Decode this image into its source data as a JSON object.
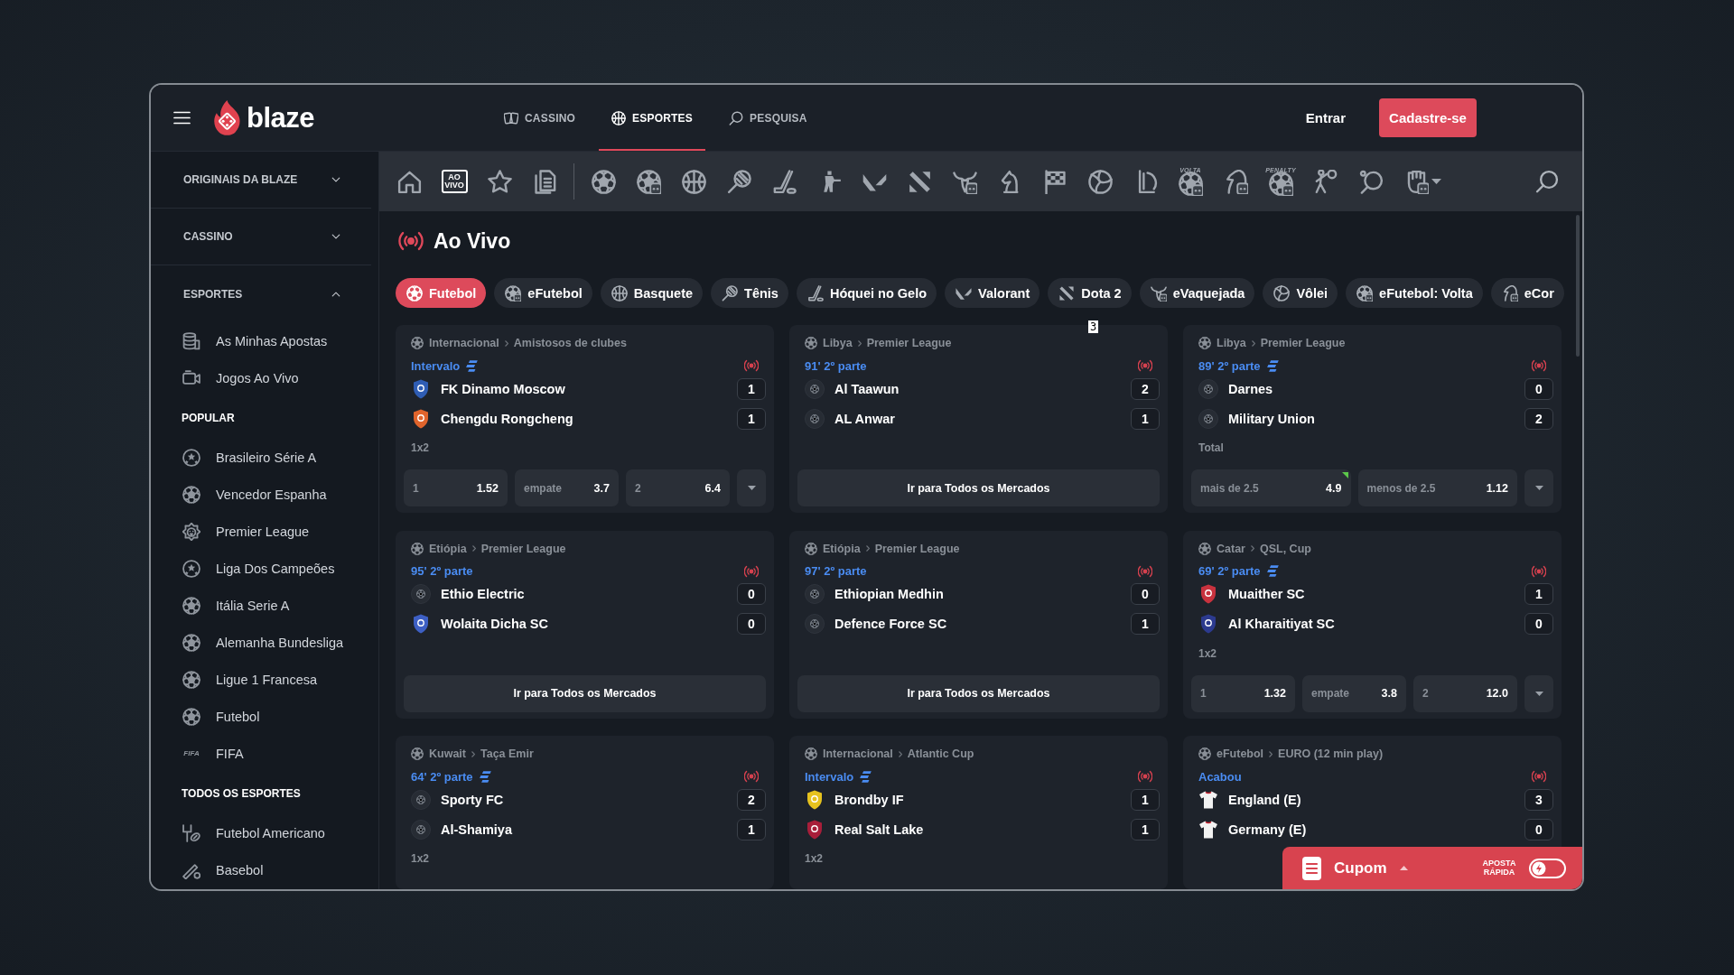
{
  "header": {
    "logo": "blaze",
    "nav": [
      {
        "label": "CASSINO",
        "selected": false
      },
      {
        "label": "ESPORTES",
        "selected": true
      },
      {
        "label": "PESQUISA",
        "selected": false
      }
    ],
    "login": "Entrar",
    "signup": "Cadastre-se"
  },
  "sidebar": {
    "sections": [
      {
        "title": "ORIGINAIS DA BLAZE",
        "expanded": false
      },
      {
        "title": "CASSINO",
        "expanded": false
      },
      {
        "title": "ESPORTES",
        "expanded": true,
        "items": [
          {
            "label": "As Minhas Apostas"
          },
          {
            "label": "Jogos Ao Vivo"
          }
        ],
        "groups": [
          {
            "title": "POPULAR",
            "items": [
              {
                "label": "Brasileiro Série A"
              },
              {
                "label": "Vencedor Espanha"
              },
              {
                "label": "Premier League"
              },
              {
                "label": "Liga Dos Campeões"
              },
              {
                "label": "Itália Serie A"
              },
              {
                "label": "Alemanha Bundesliga"
              },
              {
                "label": "Ligue 1 Francesa"
              },
              {
                "label": "Futebol"
              },
              {
                "label": "FIFA",
                "icon_text": "FIFA"
              }
            ]
          },
          {
            "title": "TODOS OS ESPORTES",
            "items": [
              {
                "label": "Futebol Americano"
              },
              {
                "label": "Basebol"
              }
            ]
          }
        ]
      }
    ]
  },
  "sport_bar": {
    "items": [
      {
        "selected": false
      },
      {
        "selected": true,
        "icon_text": "AO VIVO"
      },
      {
        "selected": false
      },
      {
        "selected": false
      },
      {
        "selected": false
      },
      {
        "selected": false
      },
      {
        "selected": false
      },
      {
        "selected": false
      },
      {
        "selected": false
      },
      {
        "selected": false
      },
      {
        "selected": false
      },
      {
        "selected": false
      },
      {
        "selected": false
      },
      {
        "selected": false
      },
      {
        "selected": false
      },
      {
        "selected": false
      },
      {
        "selected": false
      },
      {
        "selected": false,
        "icon_text": "VOLTA"
      },
      {
        "selected": false
      },
      {
        "selected": false,
        "icon_text": "PENALTY"
      },
      {
        "selected": false
      },
      {
        "selected": false
      },
      {
        "selected": false
      }
    ]
  },
  "page_title": "Ao Vivo",
  "sport_filters": [
    {
      "label": "Futebol",
      "selected": true
    },
    {
      "label": "eFutebol",
      "selected": false
    },
    {
      "label": "Basquete",
      "selected": false
    },
    {
      "label": "Tênis",
      "selected": false
    },
    {
      "label": "Hóquei no Gelo",
      "selected": false
    },
    {
      "label": "Valorant",
      "selected": false
    },
    {
      "label": "Dota 2",
      "selected": false
    },
    {
      "label": "eVaquejada",
      "selected": false
    },
    {
      "label": "Vôlei",
      "selected": false
    },
    {
      "label": "eFutebol: Volta",
      "selected": false
    },
    {
      "label": "eCor",
      "selected": false
    }
  ],
  "events": [
    {
      "country": "Internacional",
      "league": "Amistosos de clubes",
      "status": "Intervalo",
      "stream": true,
      "teams": [
        {
          "name": "FK Dinamo Moscow",
          "score": "1",
          "kind": "crest",
          "color": "#2f5db4"
        },
        {
          "name": "Chengdu Rongcheng",
          "score": "1",
          "kind": "crest",
          "color": "#e0642c"
        }
      ],
      "market": "1x2",
      "odds": [
        {
          "label": "1",
          "value": "1.52",
          "rising": false
        },
        {
          "label": "empate",
          "value": "3.7",
          "rising": false
        },
        {
          "label": "2",
          "value": "6.4",
          "rising": false
        }
      ],
      "more_markets": true
    },
    {
      "country": "Libya",
      "league": "Premier League",
      "status": "91' 2º parte",
      "stream": false,
      "teams": [
        {
          "name": "Al Taawun",
          "score": "2",
          "kind": "ball"
        },
        {
          "name": "AL Anwar",
          "score": "1",
          "kind": "ball"
        }
      ],
      "button": "Ir para Todos os Mercados"
    },
    {
      "country": "Libya",
      "league": "Premier League",
      "status": "89' 2º parte",
      "stream": true,
      "teams": [
        {
          "name": "Darnes",
          "score": "0",
          "kind": "ball"
        },
        {
          "name": "Military Union",
          "score": "2",
          "kind": "ball"
        }
      ],
      "market": "Total",
      "odds": [
        {
          "label": "mais de 2.5",
          "value": "4.9",
          "rising": true
        },
        {
          "label": "menos de 2.5",
          "value": "1.12",
          "rising": false
        }
      ],
      "more_markets": true
    },
    {
      "country": "Etiópia",
      "league": "Premier League",
      "status": "95' 2º parte",
      "stream": false,
      "teams": [
        {
          "name": "Ethio Electric",
          "score": "0",
          "kind": "ball"
        },
        {
          "name": "Wolaita Dicha SC",
          "score": "0",
          "kind": "crest",
          "color": "#3d5fc4"
        }
      ],
      "button": "Ir para Todos os Mercados"
    },
    {
      "country": "Etiópia",
      "league": "Premier League",
      "status": "97' 2º parte",
      "stream": false,
      "teams": [
        {
          "name": "Ethiopian Medhin",
          "score": "0",
          "kind": "ball"
        },
        {
          "name": "Defence Force SC",
          "score": "1",
          "kind": "ball"
        }
      ],
      "button": "Ir para Todos os Mercados"
    },
    {
      "country": "Catar",
      "league": "QSL, Cup",
      "status": "69' 2º parte",
      "stream": true,
      "teams": [
        {
          "name": "Muaither SC",
          "score": "1",
          "kind": "crest",
          "color": "#c8323e"
        },
        {
          "name": "Al Kharaitiyat SC",
          "score": "0",
          "kind": "crest",
          "color": "#2c3a8e"
        }
      ],
      "market": "1x2",
      "odds": [
        {
          "label": "1",
          "value": "1.32",
          "rising": false
        },
        {
          "label": "empate",
          "value": "3.8",
          "rising": false
        },
        {
          "label": "2",
          "value": "12.0",
          "rising": false
        }
      ],
      "more_markets": true
    },
    {
      "country": "Kuwait",
      "league": "Taça Emir",
      "status": "64' 2º parte",
      "stream": true,
      "teams": [
        {
          "name": "Sporty FC",
          "score": "2",
          "kind": "ball"
        },
        {
          "name": "Al-Shamiya",
          "score": "1",
          "kind": "ball"
        }
      ],
      "market": "1x2"
    },
    {
      "country": "Internacional",
      "league": "Atlantic Cup",
      "status": "Intervalo",
      "stream": true,
      "teams": [
        {
          "name": "Brondby IF",
          "score": "1",
          "kind": "crest",
          "color": "#e6c21e"
        },
        {
          "name": "Real Salt Lake",
          "score": "1",
          "kind": "crest",
          "color": "#a81e3a"
        }
      ],
      "market": "1x2"
    },
    {
      "country": "eFutebol",
      "league": "EURO (12 min play)",
      "status": "Acabou",
      "stream": false,
      "teams": [
        {
          "name": "England (E)",
          "score": "3",
          "kind": "shirt",
          "color": "#f2f2f2"
        },
        {
          "name": "Germany (E)",
          "score": "0",
          "kind": "shirt",
          "color": "#f2f2f2"
        }
      ]
    }
  ],
  "overlay_tag": "3",
  "coupon": {
    "label": "Cupom",
    "expanded": false,
    "quick_bet": {
      "label": "APOSTA RÁPIDA",
      "on": false
    }
  }
}
